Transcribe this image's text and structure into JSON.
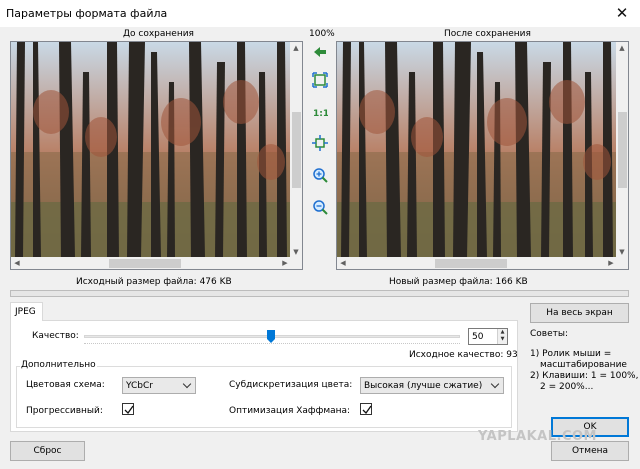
{
  "window": {
    "title": "Параметры формата файла",
    "close_glyph": "✕"
  },
  "preview": {
    "before_label": "До сохранения",
    "after_label": "После сохранения",
    "zoom_level": "100%",
    "original_size_text": "Исходный размер файла:  476 KB",
    "new_size_text": "Новый размер файла:  166 KB",
    "icons": [
      "back-arrow-icon",
      "fit-to-window-icon",
      "actual-size-icon",
      "center-icon",
      "zoom-in-icon",
      "zoom-out-icon"
    ],
    "actual_size_label": "1:1"
  },
  "tabs": [
    {
      "label": "JPEG"
    }
  ],
  "jpeg": {
    "quality_label": "Качество:",
    "quality_value": "50",
    "quality_slider_position": 0.5,
    "original_quality_text": "Исходное качество: 93",
    "advanced_title": "Дополнительно",
    "color_scheme_label": "Цветовая схема:",
    "color_scheme_value": "YCbCr",
    "subsampling_label": "Субдискретизация цвета:",
    "subsampling_value": "Высокая (лучше сжатие)",
    "progressive_label": "Прогрессивный:",
    "progressive_checked": true,
    "huffman_label": "Оптимизация Хаффмана:",
    "huffman_checked": true
  },
  "side": {
    "fullscreen_button": "На весь экран",
    "tips_title": "Советы:",
    "tip1_line1": "1) Ролик мыши =",
    "tip1_line2": "масштабирование",
    "tip2_line1": "2) Клавиши: 1 = 100%,",
    "tip2_line2": "2 = 200%..."
  },
  "buttons": {
    "reset": "Сброс",
    "ok": "OK",
    "cancel": "Отмена"
  },
  "watermark": "YAPLAKAL.COM",
  "colors": {
    "accent": "#0078d7",
    "icon_green": "#2e8b3a",
    "icon_blue": "#1f6fd0"
  }
}
